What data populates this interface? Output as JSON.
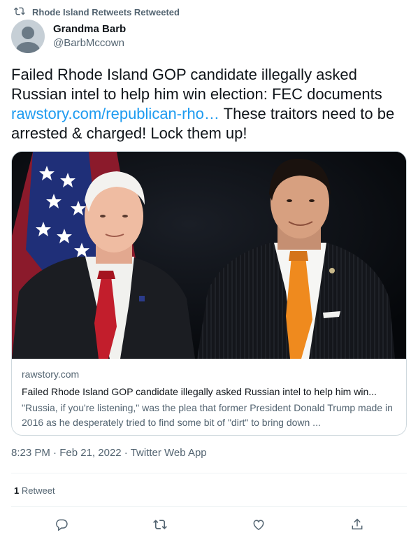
{
  "retweet_context": {
    "icon": "retweet-icon",
    "text": "Rhode Island Retweets Retweeted"
  },
  "author": {
    "name": "Grandma Barb",
    "handle": "@BarbMccown",
    "avatar_icon": "default-avatar-icon"
  },
  "tweet": {
    "text_part1": "Failed Rhode Island GOP candidate illegally asked Russian intel to help him win election: FEC documents ",
    "link_text": "rawstory.com/republican-rho…",
    "text_part2": " These traitors need to be arrested & charged! Lock them up!"
  },
  "card": {
    "domain": "rawstory.com",
    "title": "Failed Rhode Island GOP candidate illegally asked Russian intel to help him win...",
    "description": "\"Russia, if you're listening,\" was the plea that former President Donald Trump made in 2016 as he desperately tried to find some bit of \"dirt\" to bring down ..."
  },
  "meta": {
    "time": "8:23 PM",
    "date": "Feb 21, 2022",
    "source": "Twitter Web App",
    "separator": "·"
  },
  "stats": {
    "retweet_count": "1",
    "retweet_label": "Retweet"
  },
  "actions": {
    "reply_icon": "reply-icon",
    "retweet_icon": "retweet-icon",
    "like_icon": "heart-icon",
    "share_icon": "share-icon"
  },
  "colors": {
    "link": "#1d9bf0",
    "secondary": "#536471",
    "border": "#cfd9de"
  }
}
